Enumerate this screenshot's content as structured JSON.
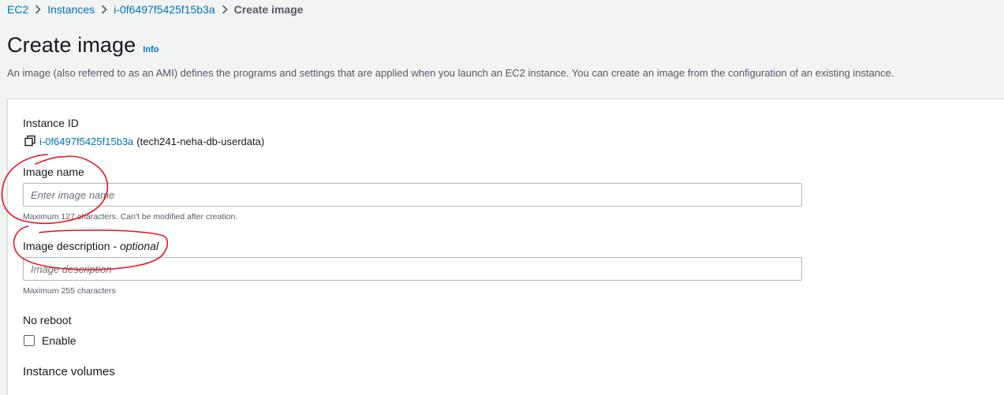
{
  "breadcrumb": {
    "items": [
      "EC2",
      "Instances",
      "i-0f6497f5425f15b3a"
    ],
    "current": "Create image"
  },
  "header": {
    "title": "Create image",
    "info_label": "Info",
    "description": "An image (also referred to as an AMI) defines the programs and settings that are applied when you launch an EC2 instance. You can create an image from the configuration of an existing instance."
  },
  "form": {
    "instance_id": {
      "label": "Instance ID",
      "id_value": "i-0f6497f5425f15b3a",
      "name_value": "(tech241-neha-db-userdata)",
      "icon": "copy-icon"
    },
    "image_name": {
      "label": "Image name",
      "placeholder": "Enter image name",
      "value": "",
      "hint": "Maximum 127 characters. Can't be modified after creation."
    },
    "image_description": {
      "label": "Image description",
      "label_optional": "optional",
      "placeholder": "Image description",
      "value": "",
      "hint": "Maximum 255 characters"
    },
    "no_reboot": {
      "label": "No reboot",
      "checkbox_label": "Enable",
      "checked": false
    },
    "instance_volumes": {
      "heading": "Instance volumes"
    }
  },
  "colors": {
    "link": "#0073bb",
    "annotation": "#e3141c",
    "background": "#f2f3f3"
  }
}
